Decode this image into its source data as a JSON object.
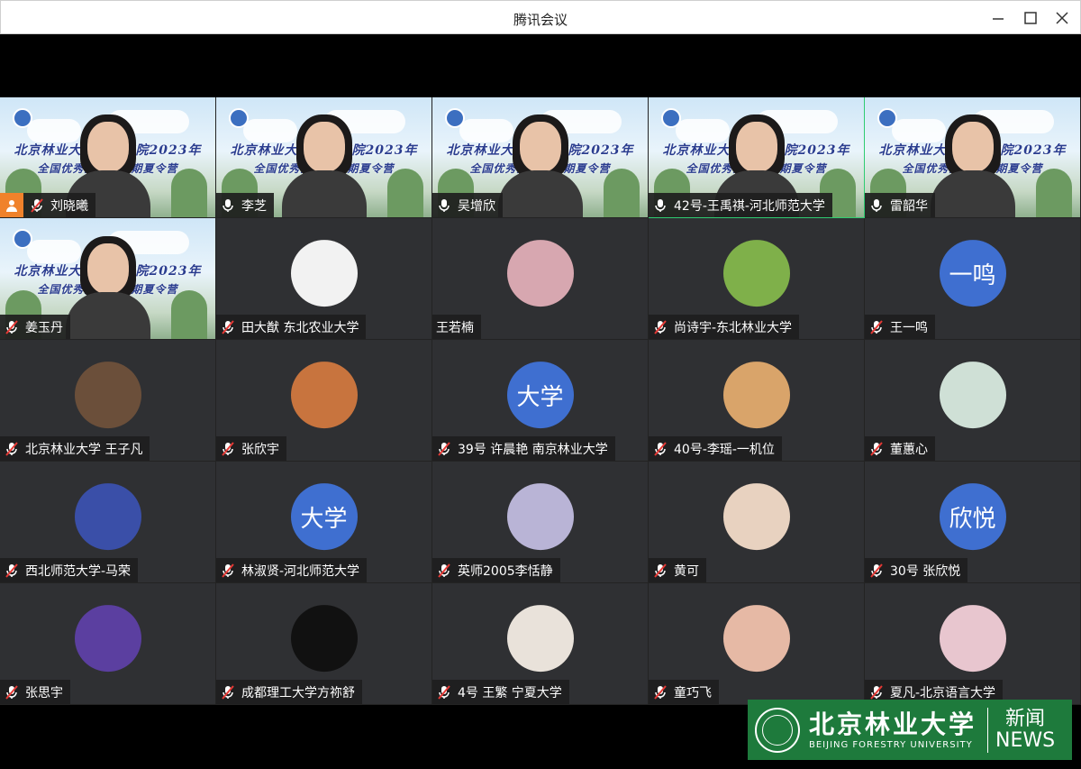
{
  "window": {
    "title": "腾讯会议",
    "controls": [
      "minimize-icon",
      "maximize-icon",
      "close-icon"
    ]
  },
  "banner": {
    "line1": "北京林业大学外语学院2023年",
    "line2": "全国优秀大学生暑期夏令营"
  },
  "tiles": [
    {
      "name": "刘晓曦",
      "type": "video",
      "mic": "muted",
      "host": true
    },
    {
      "name": "李芝",
      "type": "video",
      "mic": "on"
    },
    {
      "name": "吴增欣",
      "type": "video",
      "mic": "on"
    },
    {
      "name": "42号-王禹祺-河北师范大学",
      "type": "video",
      "mic": "on",
      "active": true
    },
    {
      "name": "雷韶华",
      "type": "video",
      "mic": "on"
    },
    {
      "name": "姜玉丹",
      "type": "video",
      "mic": "muted"
    },
    {
      "name": "田大猷 东北农业大学",
      "type": "avatar",
      "mic": "muted",
      "avatar_color": "#f2f2f2"
    },
    {
      "name": "王若楠",
      "type": "avatar",
      "mic": "none",
      "avatar_color": "#d7a7b0"
    },
    {
      "name": "尚诗宇-东北林业大学",
      "type": "avatar",
      "mic": "muted",
      "avatar_color": "#7fb04a"
    },
    {
      "name": "王一鸣",
      "type": "avatar-text",
      "mic": "muted",
      "avatar_text": "一鸣"
    },
    {
      "name": "北京林业大学 王子凡",
      "type": "avatar",
      "mic": "muted",
      "avatar_color": "#6b4f3a"
    },
    {
      "name": "张欣宇",
      "type": "avatar",
      "mic": "muted",
      "avatar_color": "#c8743e"
    },
    {
      "name": "39号 许晨艳 南京林业大学",
      "type": "avatar-text",
      "mic": "muted",
      "avatar_text": "大学"
    },
    {
      "name": "40号-李瑶-一机位",
      "type": "avatar",
      "mic": "muted",
      "avatar_color": "#d9a46a"
    },
    {
      "name": "董蕙心",
      "type": "avatar",
      "mic": "muted",
      "avatar_color": "#cfe0d6"
    },
    {
      "name": "西北师范大学-马荣",
      "type": "avatar",
      "mic": "muted",
      "avatar_color": "#3a4fa8"
    },
    {
      "name": "林淑贤-河北师范大学",
      "type": "avatar-text",
      "mic": "muted",
      "avatar_text": "大学"
    },
    {
      "name": "英师2005李恬静",
      "type": "avatar",
      "mic": "muted",
      "avatar_color": "#b9b4d6"
    },
    {
      "name": "黄可",
      "type": "avatar",
      "mic": "muted",
      "avatar_color": "#e8d2c0"
    },
    {
      "name": "30号 张欣悦",
      "type": "avatar-text",
      "mic": "muted",
      "avatar_text": "欣悦"
    },
    {
      "name": "张思宇",
      "type": "avatar",
      "mic": "muted",
      "avatar_color": "#5b3fa0"
    },
    {
      "name": "成都理工大学方祢舒",
      "type": "avatar",
      "mic": "muted",
      "avatar_color": "#111111"
    },
    {
      "name": "4号 王繁 宁夏大学",
      "type": "avatar",
      "mic": "muted",
      "avatar_color": "#e9e2da"
    },
    {
      "name": "童巧飞",
      "type": "avatar",
      "mic": "muted",
      "avatar_color": "#e6b9a5"
    },
    {
      "name": "夏凡-北京语言大学",
      "type": "avatar",
      "mic": "muted",
      "avatar_color": "#e8c6cf"
    }
  ],
  "watermark": {
    "cn": "北京林业大学",
    "en": "BEIJING FORESTRY UNIVERSITY",
    "news_cn": "新闻",
    "news_en": "NEWS"
  },
  "colors": {
    "active_border": "#2ecc71",
    "host_badge": "#f0822b",
    "text_avatar": "#3f6fd0",
    "watermark_bg": "#1e7a3c"
  }
}
